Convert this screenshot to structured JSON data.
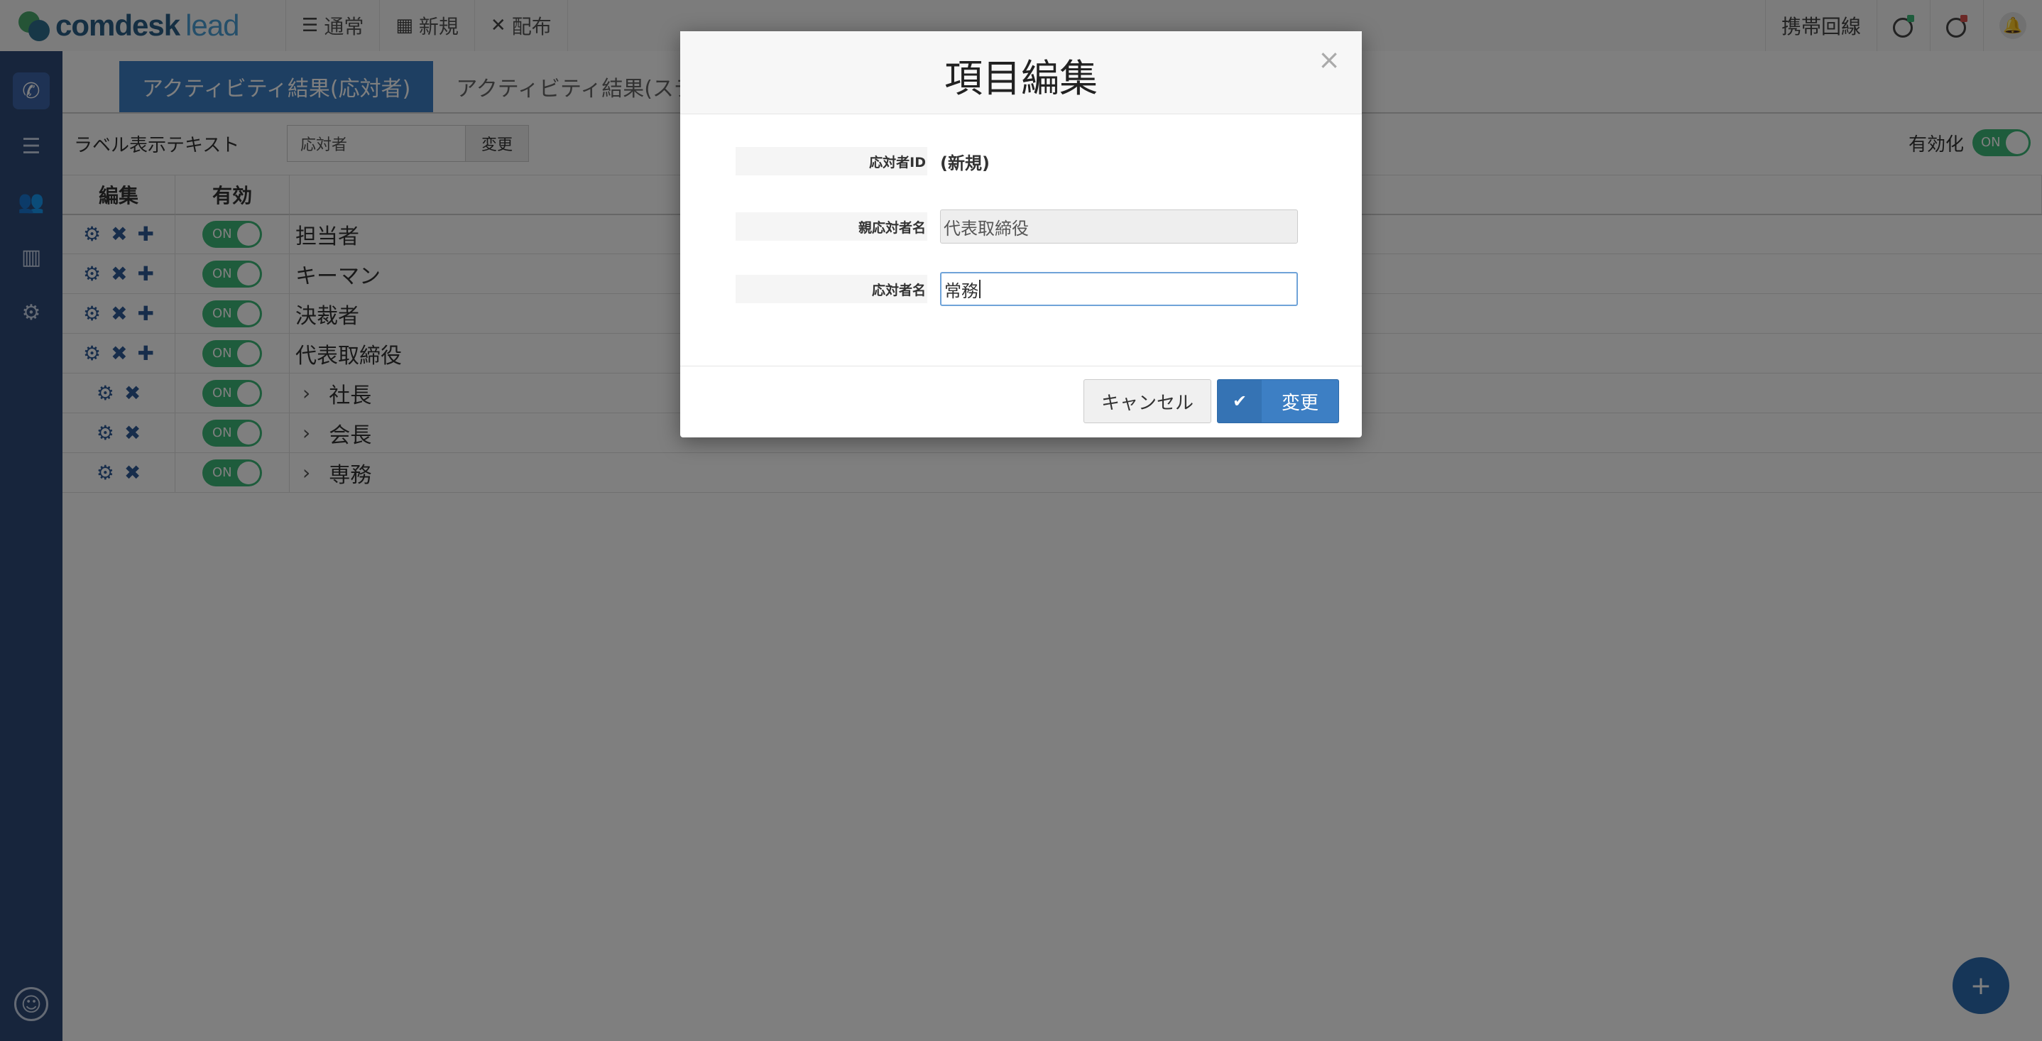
{
  "app": {
    "logo_main": "comdesk",
    "logo_sub": "lead"
  },
  "topnav": [
    {
      "icon": "☰",
      "label": "通常"
    },
    {
      "icon": "▦",
      "label": "新規"
    },
    {
      "icon": "✕",
      "label": "配布"
    }
  ],
  "topright": {
    "mobile_line": "携帯回線"
  },
  "tabs": {
    "active": "アクティビティ結果(応対者)",
    "inactive": "アクティビティ結果(ステータス)"
  },
  "label_row": {
    "label": "ラベル表示テキスト",
    "value": "応対者",
    "button": "変更"
  },
  "enable": {
    "label": "有効化",
    "state": "ON"
  },
  "grid": {
    "headers": {
      "edit": "編集",
      "valid": "有効"
    },
    "rows": [
      {
        "name": "担当者",
        "toggle": "ON",
        "child": false
      },
      {
        "name": "キーマン",
        "toggle": "ON",
        "child": false
      },
      {
        "name": "決裁者",
        "toggle": "ON",
        "child": false
      },
      {
        "name": "代表取締役",
        "toggle": "ON",
        "child": false
      },
      {
        "name": "社長",
        "toggle": "ON",
        "child": true
      },
      {
        "name": "会長",
        "toggle": "ON",
        "child": true
      },
      {
        "name": "専務",
        "toggle": "ON",
        "child": true
      }
    ]
  },
  "fab_label": "+",
  "modal": {
    "title": "項目編集",
    "close": "×",
    "fields": {
      "id_label": "応対者ID",
      "id_value": "(新規)",
      "parent_label": "親応対者名",
      "parent_value": "代表取締役",
      "name_label": "応対者名",
      "name_value": "常務"
    },
    "cancel": "キャンセル",
    "submit": "変更"
  }
}
